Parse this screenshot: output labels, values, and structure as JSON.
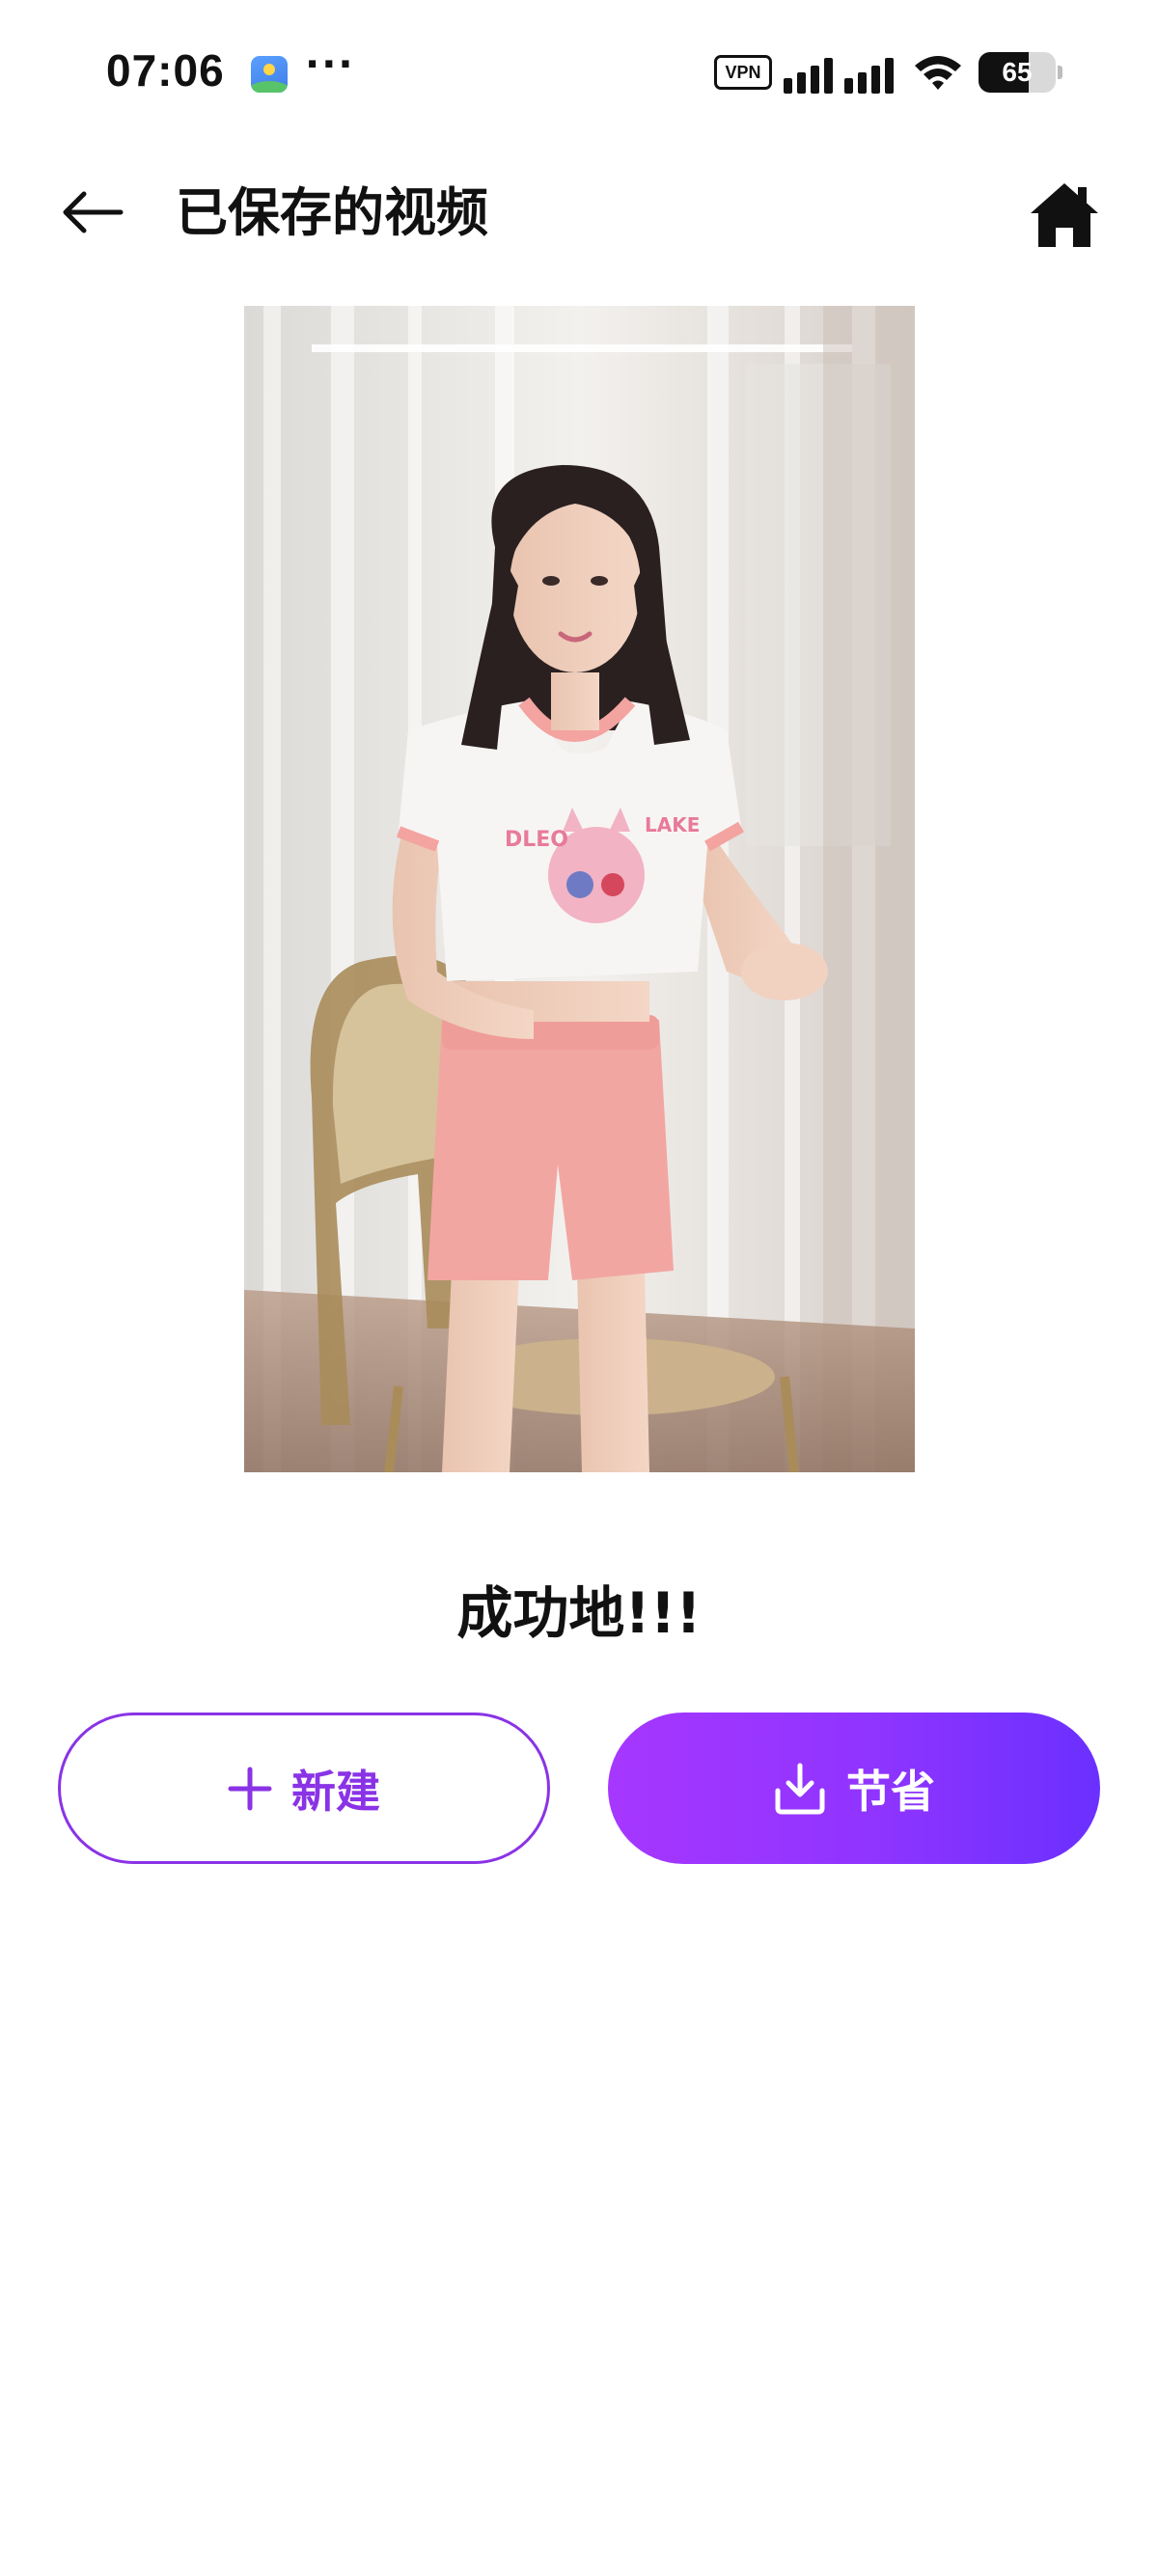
{
  "status_bar": {
    "time": "07:06",
    "app_icon": "gallery-icon",
    "more": "···",
    "vpn": "VPN",
    "battery": "65",
    "battery_level": 0.65
  },
  "header": {
    "back_icon": "back-arrow-icon",
    "title": "已保存的视频",
    "home_icon": "home-icon"
  },
  "video": {
    "content": "dancing-girl-video-thumbnail"
  },
  "result": {
    "message": "成功地!!!"
  },
  "actions": {
    "new_label": "新建",
    "new_icon": "plus-icon",
    "save_label": "节省",
    "save_icon": "download-icon"
  },
  "colors": {
    "accent": "#8a33e6",
    "gradient_start": "#a637ff",
    "gradient_end": "#6a30ff"
  }
}
